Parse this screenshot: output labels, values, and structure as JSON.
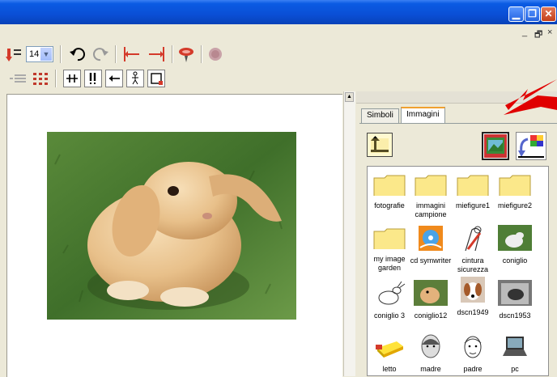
{
  "toolbar": {
    "font_size": "14"
  },
  "panel": {
    "tabs": [
      {
        "label": "Simboli"
      },
      {
        "label": "Immagini"
      }
    ],
    "items": [
      {
        "label": "fotografie"
      },
      {
        "label": "immagini campione"
      },
      {
        "label": "miefigure1"
      },
      {
        "label": "miefigure2"
      },
      {
        "label": "my image garden"
      },
      {
        "label": "cd symwriter"
      },
      {
        "label": "cintura sicurezza"
      },
      {
        "label": "coniglio"
      },
      {
        "label": "coniglio 3"
      },
      {
        "label": "coniglio12"
      },
      {
        "label": "dscn1949"
      },
      {
        "label": "dscn1953"
      },
      {
        "label": "letto"
      },
      {
        "label": "madre"
      },
      {
        "label": "padre"
      },
      {
        "label": "pc"
      }
    ]
  },
  "colors": {
    "titlebar": "#0a4fd6",
    "arrow": "#e00000",
    "folder": "#fbe88a"
  }
}
